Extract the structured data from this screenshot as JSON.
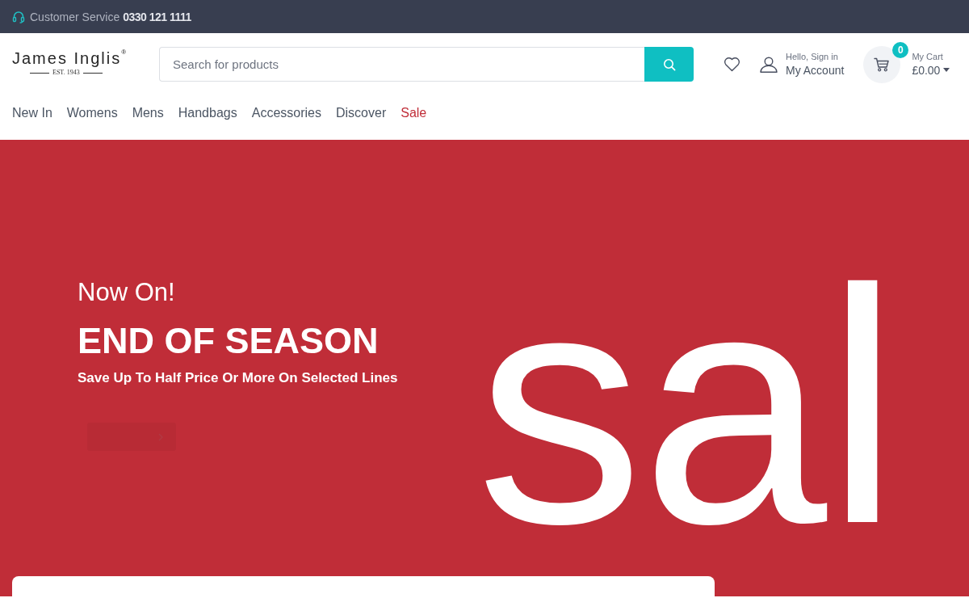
{
  "top_bar": {
    "label": "Customer Service",
    "phone": "0330 121 1111"
  },
  "header": {
    "logo": {
      "name": "James Inglis$^{®}$",
      "tagline": "EST. 1943"
    },
    "search": {
      "placeholder": "Search for products"
    },
    "account": {
      "greeting": "Hello, Sign in",
      "label": "My Account"
    },
    "cart": {
      "count": "0",
      "label": "My Cart",
      "total": "£0.00"
    }
  },
  "nav": [
    {
      "label": "New In",
      "highlighted": false
    },
    {
      "label": "Womens",
      "highlighted": false
    },
    {
      "label": "Mens",
      "highlighted": false
    },
    {
      "label": "Handbags",
      "highlighted": false
    },
    {
      "label": "Accessories",
      "highlighted": false
    },
    {
      "label": "Discover",
      "highlighted": false
    },
    {
      "label": "Sale",
      "highlighted": true
    }
  ],
  "hero": {
    "kicker": "Now On!",
    "title": "END OF SEASON",
    "subtitle": "Save Up To Half Price Or More On Selected Lines",
    "artwork_text": "sal"
  }
}
